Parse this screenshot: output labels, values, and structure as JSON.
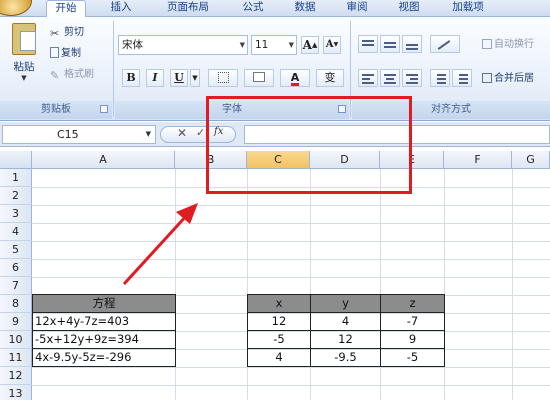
{
  "ribbon_tabs": [
    "开始",
    "插入",
    "页面布局",
    "公式",
    "数据",
    "审阅",
    "视图",
    "加载项"
  ],
  "clipboard": {
    "paste": "粘贴",
    "cut": "剪切",
    "copy": "复制",
    "format_painter": "格式刷",
    "label": "剪贴板"
  },
  "font": {
    "name": "宋体",
    "size": "11",
    "grow": "A",
    "shrink": "A",
    "bold": "B",
    "italic": "I",
    "underline": "U",
    "color_letter": "A",
    "phonetic": "变",
    "label": "字体",
    "accent_color": "#e01b22"
  },
  "alignment": {
    "wrap_text": "自动换行",
    "merge_center": "合并后居",
    "label": "对齐方式"
  },
  "formula_bar": {
    "cell_ref": "C15",
    "cancel": "✕",
    "enter": "✓",
    "fx": "fx",
    "value": ""
  },
  "columns": [
    "A",
    "B",
    "C",
    "D",
    "E",
    "F",
    "G"
  ],
  "rows": [
    "1",
    "2",
    "3",
    "4",
    "5",
    "6",
    "7",
    "8",
    "9",
    "10",
    "11",
    "12",
    "13"
  ],
  "equations_table": {
    "header": "方程",
    "rows": [
      "12x+4y-7z=403",
      "-5x+12y+9z=394",
      "4x-9.5y-5z=-296"
    ]
  },
  "coeff_table": {
    "headers": [
      "x",
      "y",
      "z"
    ],
    "rows": [
      [
        "12",
        "4",
        "-7"
      ],
      [
        "-5",
        "12",
        "9"
      ],
      [
        "4",
        "-9.5",
        "-5"
      ]
    ]
  },
  "highlight_color": "#e01b22"
}
